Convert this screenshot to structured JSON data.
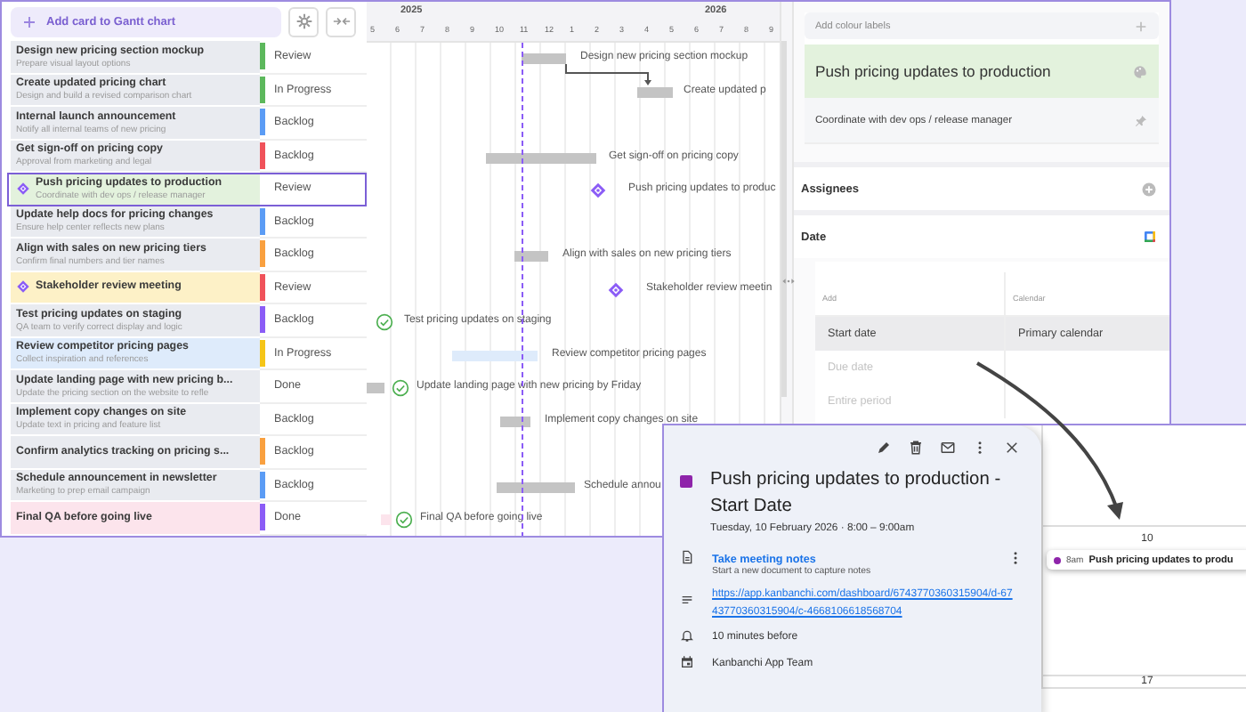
{
  "toolbar": {
    "add_button": "Add card to Gantt chart"
  },
  "timeline": {
    "years": [
      "2025",
      "2026"
    ],
    "months": [
      "5",
      "6",
      "7",
      "8",
      "9",
      "10",
      "11",
      "12",
      "1",
      "2",
      "3",
      "4",
      "5",
      "6",
      "7",
      "8",
      "9"
    ]
  },
  "cards": [
    {
      "title": "Design new pricing section mockup",
      "subtitle": "Prepare visual layout options",
      "status": {
        "label": "Review",
        "color": "#5cb85c"
      },
      "milestone": false,
      "selected": false,
      "gantt": {
        "kind": "bar",
        "label": "Design new pricing section mockup"
      }
    },
    {
      "title": "Create updated pricing chart",
      "subtitle": "Design and build a revised comparison chart",
      "status": {
        "label": "In Progress",
        "color": "#5cb85c"
      },
      "milestone": false,
      "selected": false,
      "gantt": {
        "kind": "bar",
        "label": "Create updated p"
      }
    },
    {
      "title": "Internal launch announcement",
      "subtitle": "Notify all internal teams of new pricing",
      "status": {
        "label": "Backlog",
        "color": "#5b9cf5"
      },
      "milestone": false,
      "selected": false
    },
    {
      "title": "Get sign-off on pricing copy",
      "subtitle": "Approval from marketing and legal",
      "status": {
        "label": "Backlog",
        "color": "#f0525a"
      },
      "milestone": false,
      "selected": false,
      "gantt": {
        "kind": "bar",
        "label": "Get sign-off on pricing copy"
      }
    },
    {
      "title": "Push pricing updates to production",
      "subtitle": "Coordinate with dev ops / release manager",
      "status": {
        "label": "Review"
      },
      "color": "#e3f2dd",
      "milestone": true,
      "selected": true,
      "gantt": {
        "kind": "milestone",
        "label": "Push pricing updates to produc"
      }
    },
    {
      "title": "Update help docs for pricing changes",
      "subtitle": "Ensure help center reflects new plans",
      "status": {
        "label": "Backlog",
        "color": "#5b9cf5"
      },
      "milestone": false,
      "selected": false
    },
    {
      "title": "Align with sales on new pricing tiers",
      "subtitle": "Confirm final numbers and tier names",
      "status": {
        "label": "Backlog",
        "color": "#f9a03f"
      },
      "milestone": false,
      "selected": false,
      "gantt": {
        "kind": "bar",
        "label": "Align with sales on new pricing tiers"
      }
    },
    {
      "title": "Stakeholder review meeting",
      "status": {
        "label": "Review",
        "color": "#f0525a"
      },
      "color": "#fdf1c7",
      "milestone": true,
      "selected": false,
      "gantt": {
        "kind": "milestone",
        "label": "Stakeholder review meetin"
      }
    },
    {
      "title": "Test pricing updates on staging",
      "subtitle": "QA team to verify correct display and logic",
      "status": {
        "label": "Backlog",
        "color": "#8b5cf6"
      },
      "milestone": false,
      "selected": false,
      "gantt": {
        "kind": "done",
        "label": "Test pricing updates on staging"
      }
    },
    {
      "title": "Review competitor pricing pages",
      "subtitle": "Collect inspiration and references",
      "status": {
        "label": "In Progress",
        "color": "#f5c518"
      },
      "color": "#deebfb",
      "milestone": false,
      "selected": false,
      "gantt": {
        "kind": "bar",
        "label": "Review competitor pricing pages"
      }
    },
    {
      "title": "Update landing page with new pricing b...",
      "subtitle": "Update the pricing section on the website to refle",
      "status": {
        "label": "Done"
      },
      "milestone": false,
      "selected": false,
      "gantt": {
        "kind": "done",
        "label": "Update landing page with new pricing by Friday"
      }
    },
    {
      "title": "Implement copy changes on site",
      "subtitle": "Update text in pricing and feature list",
      "status": {
        "label": "Backlog"
      },
      "milestone": false,
      "selected": false,
      "gantt": {
        "kind": "bar",
        "label": "Implement copy changes on site"
      }
    },
    {
      "title": "Confirm analytics tracking on pricing s...",
      "status": {
        "label": "Backlog",
        "color": "#f9a03f"
      },
      "milestone": false,
      "selected": false
    },
    {
      "title": "Schedule announcement in newsletter",
      "subtitle": "Marketing to prep email campaign",
      "status": {
        "label": "Backlog",
        "color": "#5b9cf5"
      },
      "milestone": false,
      "selected": false,
      "gantt": {
        "kind": "bar",
        "label": "Schedule annou"
      }
    },
    {
      "title": "Final QA before going live",
      "status": {
        "label": "Done",
        "color": "#8b5cf6"
      },
      "color": "#fce4ec",
      "milestone": false,
      "selected": false,
      "gantt": {
        "kind": "done",
        "label": "Final QA before going live"
      }
    }
  ],
  "details": {
    "labels_placeholder": "Add colour labels",
    "title": "Push pricing updates to production",
    "description": "Coordinate with dev ops / release manager",
    "assignees": "Assignees",
    "date": "Date",
    "date_table": {
      "columns": [
        "Add",
        "Calendar"
      ],
      "rows": [
        {
          "label": "Start date",
          "calendar": "Primary calendar",
          "selected": true,
          "disabled": false
        },
        {
          "label": "Due date",
          "selected": false,
          "disabled": true
        },
        {
          "label": "Entire period",
          "selected": false,
          "disabled": true
        }
      ]
    }
  },
  "calendar": {
    "event": {
      "color": "#8e24aa",
      "title": "Push pricing updates to production - Start Date",
      "when": "Tuesday, 10 February 2026 · 8:00 – 9:00am",
      "notes_link": "Take meeting notes",
      "notes_hint": "Start a new document to capture notes",
      "url": "https://app.kanbanchi.com/dashboard/6743770360315904/d-6743770360315904/c-4668106618568704",
      "reminder": "10 minutes before",
      "calendar": "Kanbanchi App Team"
    },
    "days": [
      {
        "label": "10",
        "events": [
          {
            "time": "8am",
            "title": "Push pricing updates to produ",
            "color": "#8e24aa"
          }
        ]
      },
      {
        "label": "17"
      }
    ]
  }
}
